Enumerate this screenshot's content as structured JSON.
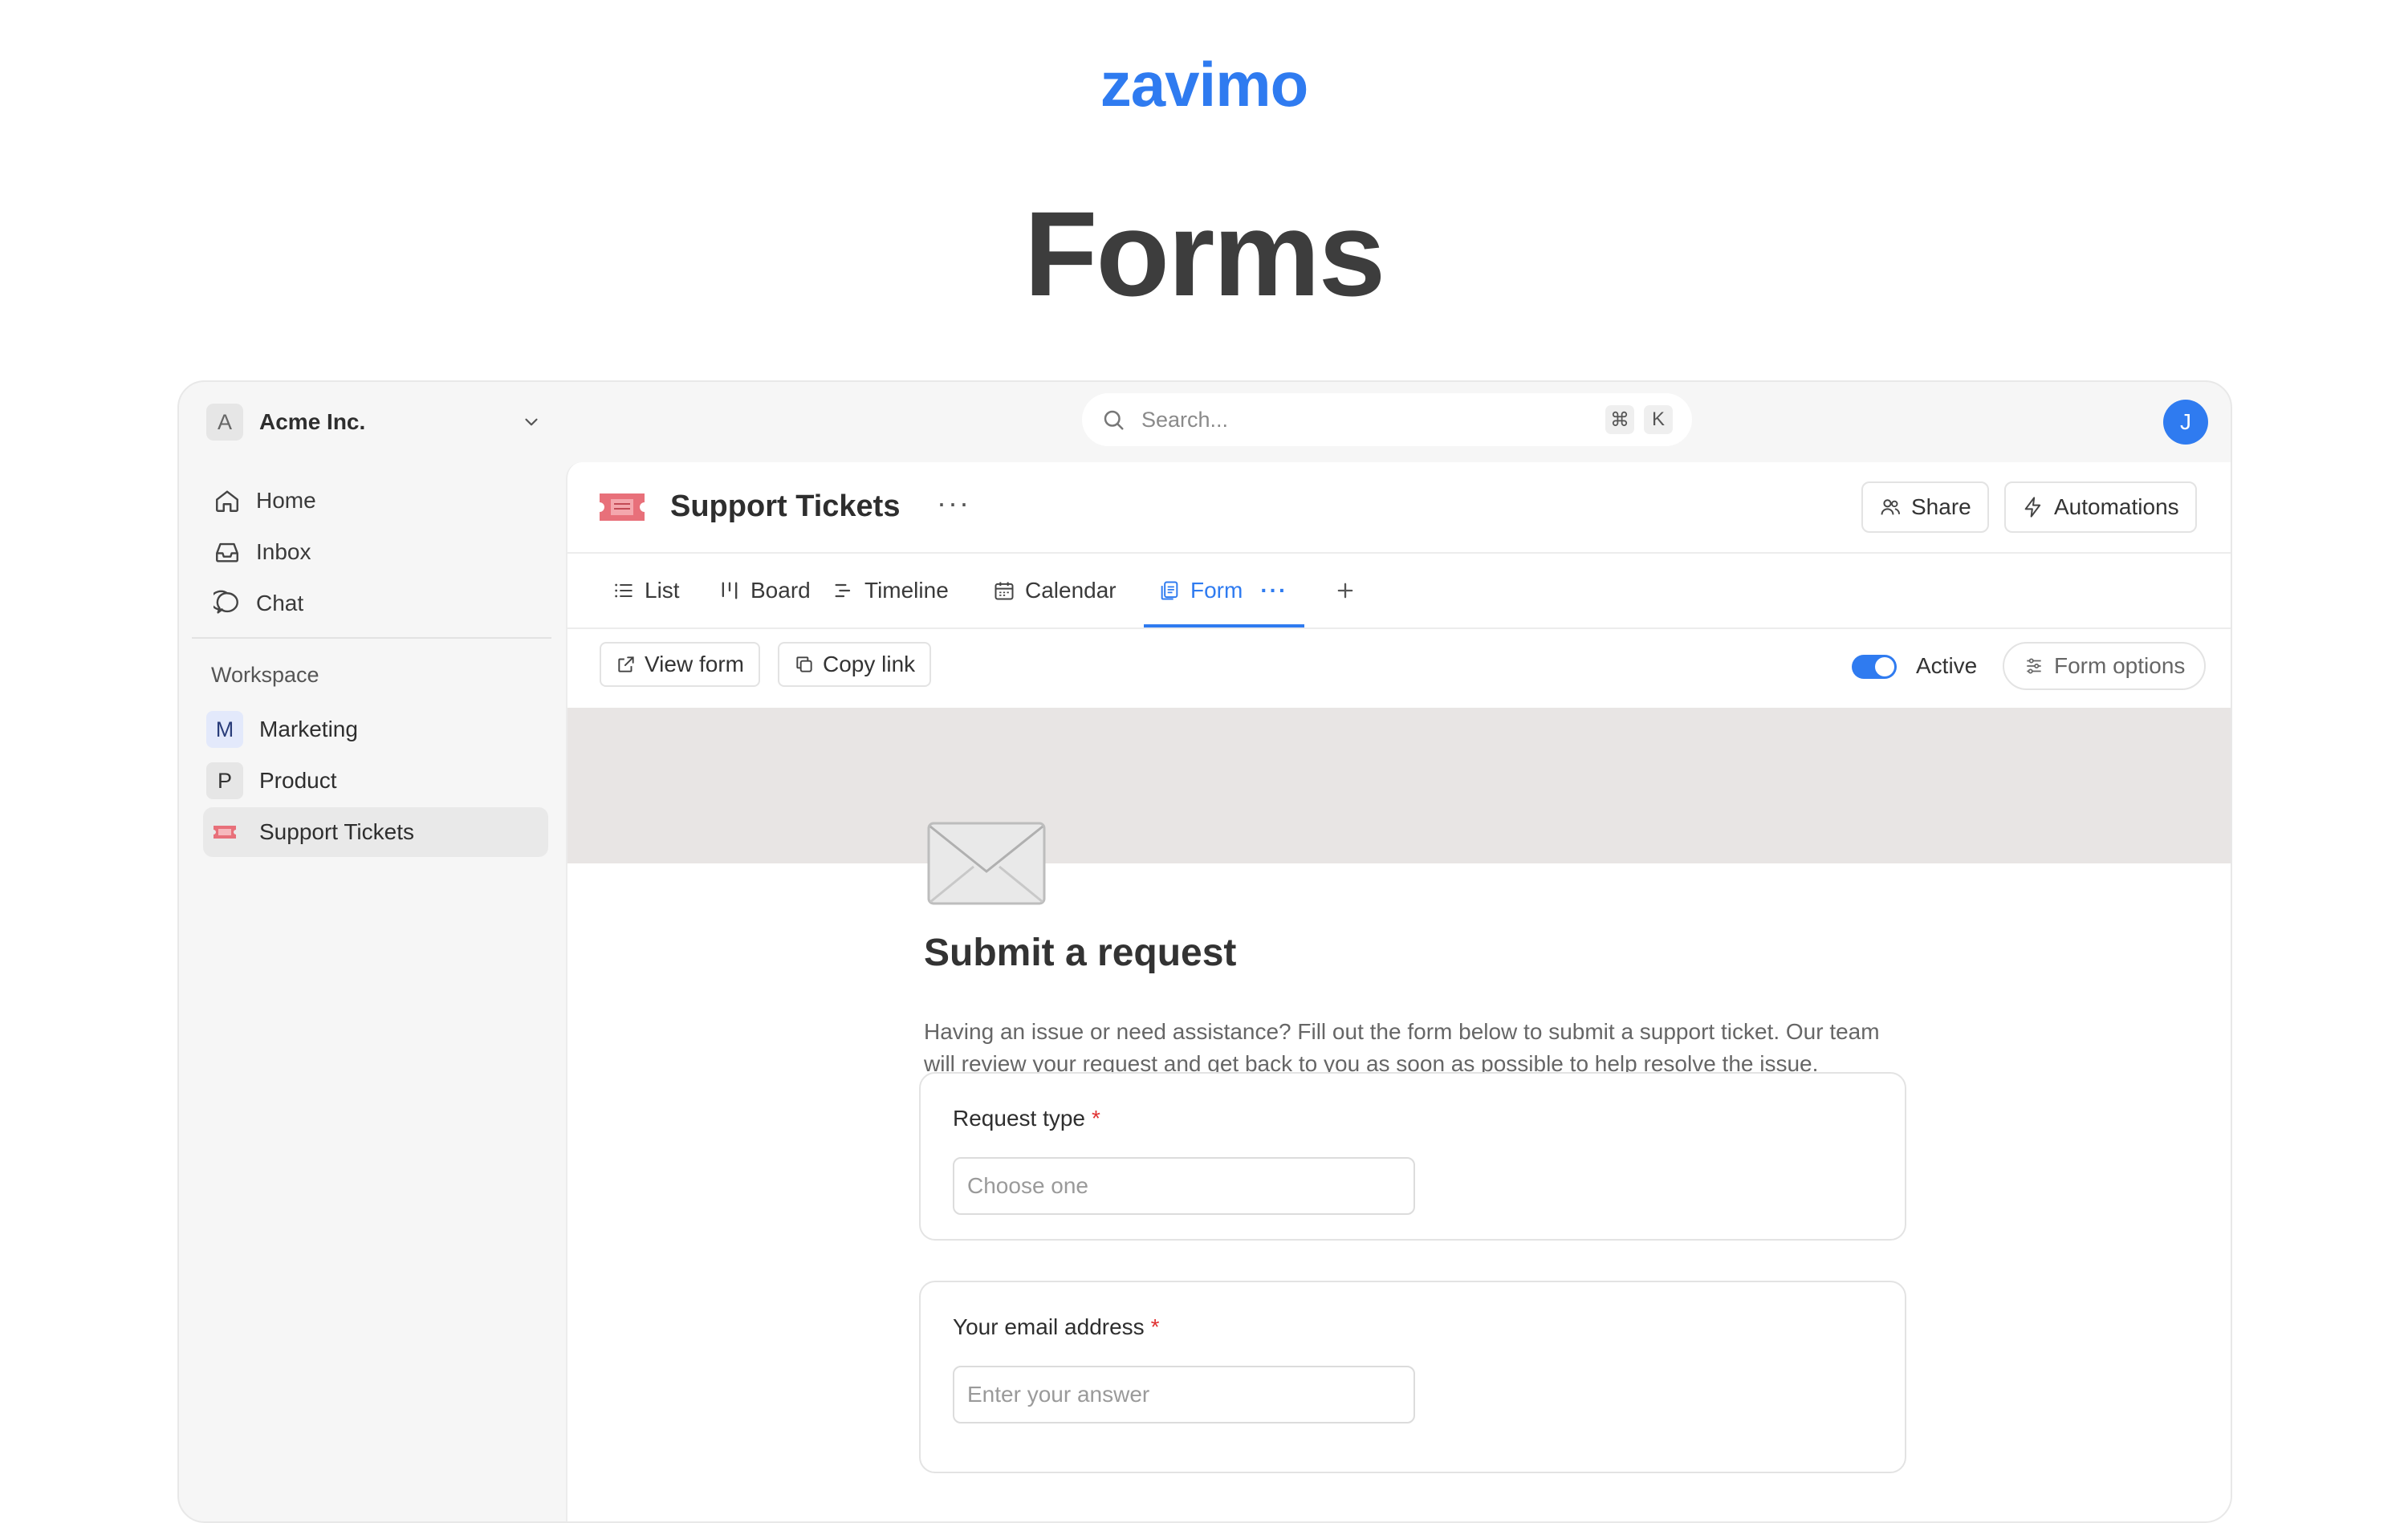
{
  "brand": "zavimo",
  "hero_title": "Forms",
  "workspace": {
    "badge": "A",
    "name": "Acme Inc."
  },
  "search": {
    "placeholder": "Search...",
    "shortcut_key1": "⌘",
    "shortcut_key2": "K"
  },
  "user": {
    "initial": "J"
  },
  "nav": [
    {
      "label": "Home",
      "icon": "home-icon"
    },
    {
      "label": "Inbox",
      "icon": "inbox-icon"
    },
    {
      "label": "Chat",
      "icon": "chat-icon"
    }
  ],
  "workspace_section": {
    "title": "Workspace",
    "items": [
      {
        "badge": "M",
        "label": "Marketing"
      },
      {
        "badge": "P",
        "label": "Product"
      },
      {
        "badge": "🎟️",
        "label": "Support Tickets",
        "active": true
      }
    ]
  },
  "page": {
    "title": "Support Tickets",
    "more": "···",
    "share_label": "Share",
    "automations_label": "Automations"
  },
  "tabs": [
    {
      "label": "List",
      "icon": "list-icon"
    },
    {
      "label": "Board",
      "icon": "board-icon"
    },
    {
      "label": "Timeline",
      "icon": "timeline-icon"
    },
    {
      "label": "Calendar",
      "icon": "calendar-icon"
    },
    {
      "label": "Form",
      "icon": "form-icon",
      "active": true
    }
  ],
  "toolbar": {
    "view_form": "View form",
    "copy_link": "Copy link",
    "active_label": "Active",
    "active_on": true,
    "form_options": "Form options"
  },
  "form": {
    "title": "Submit a request",
    "description": "Having an issue or need assistance? Fill out the form below to submit a support ticket. Our team will review your request and get back to you as soon as possible to help resolve the issue.",
    "questions": [
      {
        "label": "Request type",
        "required": "*",
        "placeholder": "Choose one"
      },
      {
        "label": "Your email address",
        "required": "*",
        "placeholder": "Enter your answer"
      }
    ]
  },
  "colors": {
    "accent": "#2f7bf0",
    "required": "#e03131",
    "cover": "#e8e5e4"
  }
}
